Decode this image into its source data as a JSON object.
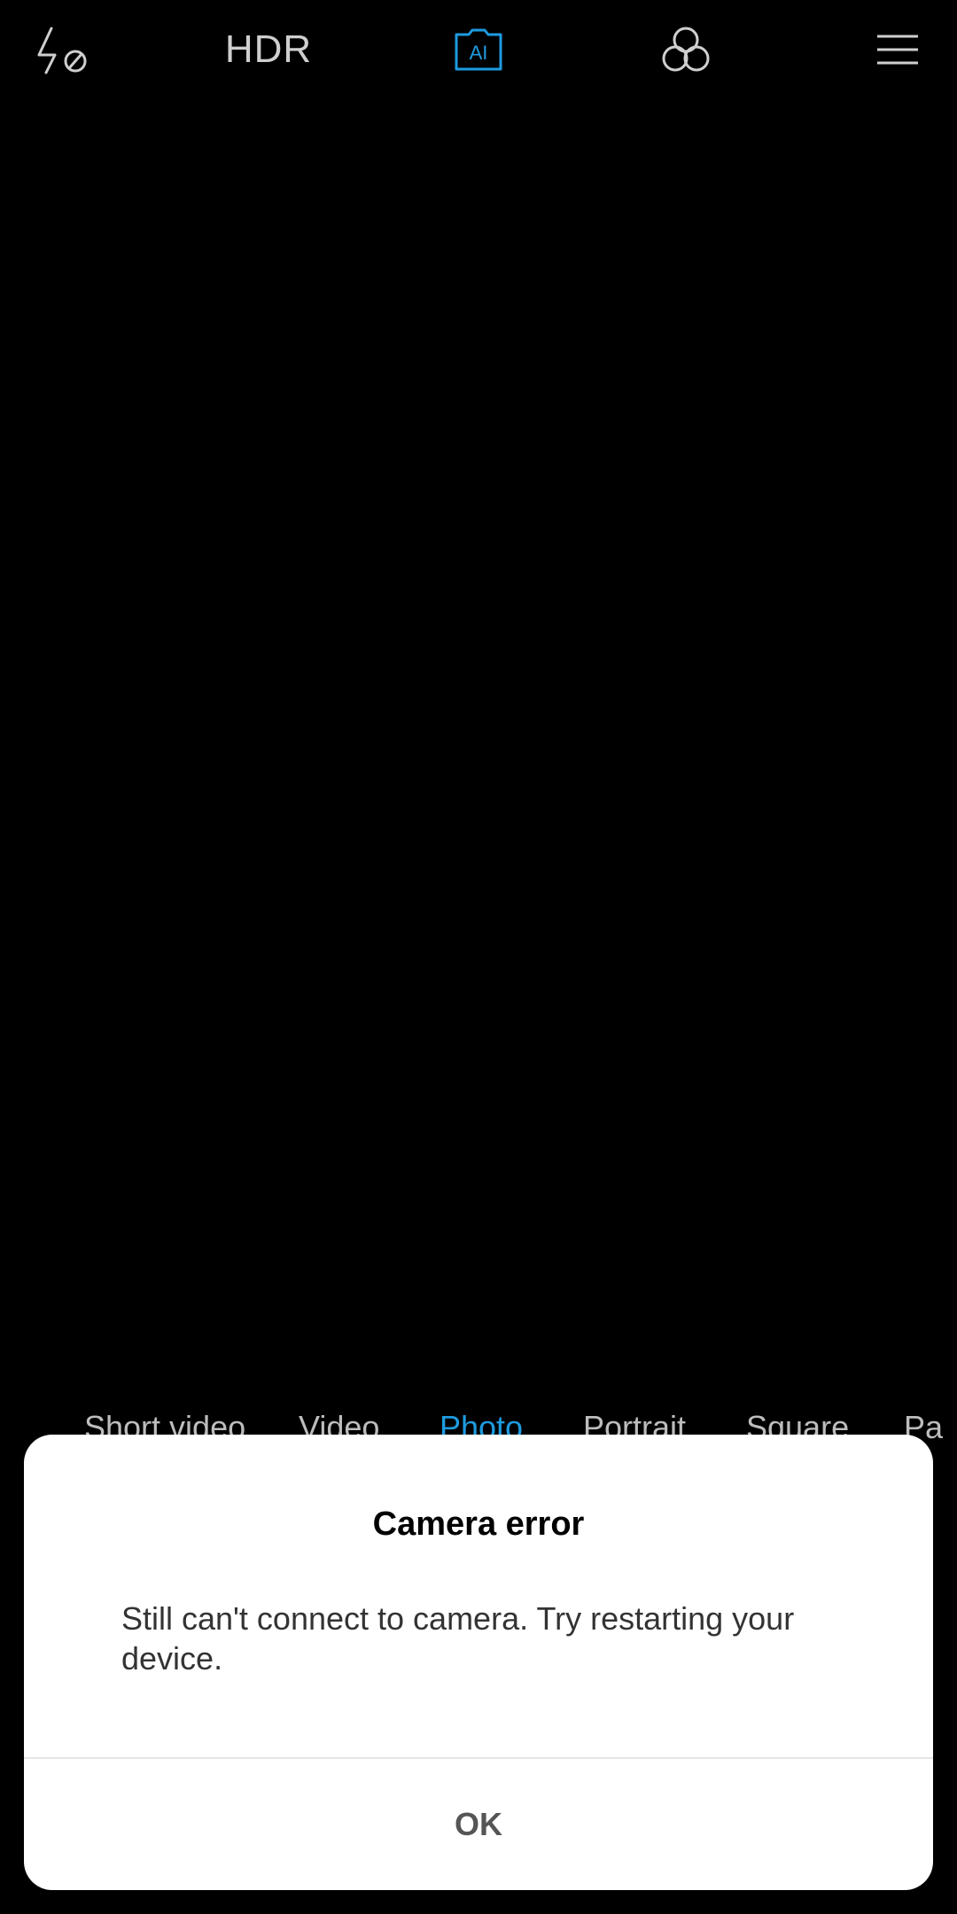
{
  "topbar": {
    "flash_icon": "flash-off-icon",
    "hdr_label": "HDR",
    "ai_label": "AI",
    "ai_color": "#1e9be0",
    "filter_icon": "filters-icon",
    "menu_icon": "menu-icon"
  },
  "modes": {
    "items": [
      "Short video",
      "Video",
      "Photo",
      "Portrait",
      "Square",
      "Pa"
    ],
    "active": "Photo"
  },
  "dialog": {
    "title": "Camera error",
    "message": "Still can't connect to camera. Try restarting your device.",
    "ok_label": "OK"
  }
}
